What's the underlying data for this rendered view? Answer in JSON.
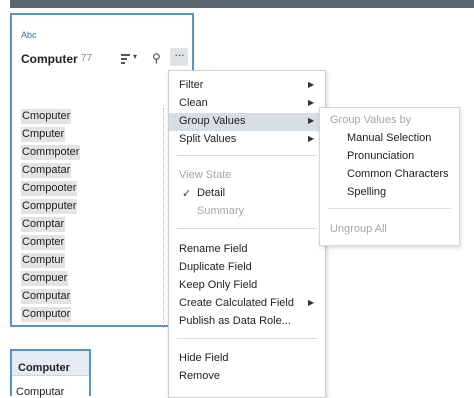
{
  "card": {
    "type_label": "Abc",
    "field_name": "Computer",
    "count": "77",
    "values": [
      "Cmoputer",
      "Cmputer",
      "Commpoter",
      "Compatar",
      "Compooter",
      "Compputer",
      "Comptar",
      "Compter",
      "Comptur",
      "Compuer",
      "Computar",
      "Computor"
    ]
  },
  "bottom_card": {
    "title": "Computer",
    "value": "Computar"
  },
  "menu": {
    "filter": "Filter",
    "clean": "Clean",
    "group_values": "Group Values",
    "split_values": "Split Values",
    "view_state": "View State",
    "detail": "Detail",
    "summary": "Summary",
    "rename_field": "Rename Field",
    "duplicate_field": "Duplicate Field",
    "keep_only_field": "Keep Only Field",
    "create_calculated_field": "Create Calculated Field",
    "publish_as_data_role": "Publish as Data Role...",
    "hide_field": "Hide Field",
    "remove": "Remove"
  },
  "submenu": {
    "heading": "Group Values by",
    "manual_selection": "Manual Selection",
    "pronunciation": "Pronunciation",
    "common_characters": "Common Characters",
    "spelling": "Spelling",
    "ungroup_all": "Ungroup All"
  },
  "icons": {
    "sort": "sort-icon",
    "search": "search-icon",
    "more": "more-icon",
    "submenu_arrow": "chevron-right-icon",
    "check": "check-icon"
  },
  "colors": {
    "card_border": "#5b93c7",
    "highlight": "#d7dde4",
    "disabled_text": "#a6a6a6",
    "type_label": "#3b6fb0"
  }
}
